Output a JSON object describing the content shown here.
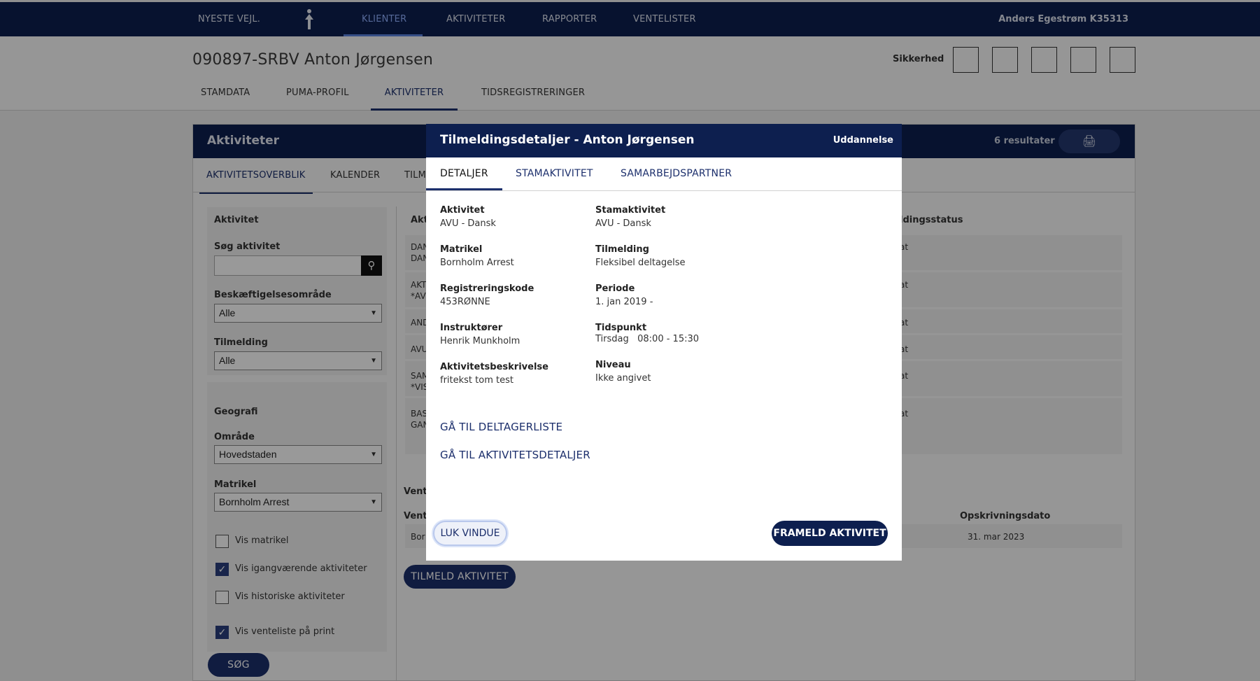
{
  "topnav": {
    "items": [
      {
        "label": "NYESTE VEJL."
      },
      {
        "label": "KLIENTER"
      },
      {
        "label": "AKTIVITETER"
      },
      {
        "label": "RAPPORTER"
      },
      {
        "label": "VENTELISTER"
      }
    ],
    "user": "Anders Egestrøm K35313"
  },
  "client": {
    "title": "090897-SRBV Anton Jørgensen",
    "security_label": "Sikkerhed",
    "tabs": [
      {
        "label": "STAMDATA"
      },
      {
        "label": "PUMA-PROFIL"
      },
      {
        "label": "AKTIVITETER"
      },
      {
        "label": "TIDSREGISTRERINGER"
      }
    ]
  },
  "panel": {
    "title": "Aktiviteter",
    "results": "6 resultater",
    "tabs": [
      {
        "label": "AKTIVITETSOVERBLIK"
      },
      {
        "label": "KALENDER"
      },
      {
        "label": "TILM"
      }
    ]
  },
  "filters": {
    "heading": "Aktivitet",
    "search_label": "Søg aktivitet",
    "search_value": "",
    "area_label": "Beskæftigelsesområde",
    "area_value": "Alle",
    "enrollment_label": "Tilmelding",
    "enrollment_value": "Alle",
    "geo_heading": "Geografi",
    "region_label": "Område",
    "region_value": "Hovedstaden",
    "site_label": "Matrikel",
    "site_value": "Bornholm Arrest",
    "checks": [
      {
        "label": "Vis matrikel",
        "checked": false
      },
      {
        "label": "Vis igangværende aktiviteter",
        "checked": true
      },
      {
        "label": "Vis historiske aktiviteter",
        "checked": false
      },
      {
        "label": "Vis venteliste på print",
        "checked": true
      }
    ],
    "search_button": "SØG"
  },
  "table": {
    "col_activity": "Akt",
    "col_status": "ldingsstatus",
    "rows": [
      {
        "a": "DAN",
        "b": "DAN",
        "status": "at"
      },
      {
        "a": "AKT",
        "b": "*AVU",
        "status": "at"
      },
      {
        "a": "AND",
        "b": "",
        "status": "at"
      },
      {
        "a": "AVU",
        "b": "",
        "status": "at"
      },
      {
        "a": "SAM",
        "b": "*VIS",
        "status": "at"
      },
      {
        "a": "BAS",
        "b": "GAN",
        "status": "at"
      }
    ],
    "waitlist_heading": "Vent",
    "waitlist_col": "Vent",
    "waitlist_date_col": "Opskrivningsdato",
    "waitlist_row_site": "Bor",
    "waitlist_row_date": "31. mar 2023",
    "enroll_button": "TILMELD AKTIVITET"
  },
  "modal": {
    "title": "Tilmeldingsdetaljer - Anton Jørgensen",
    "category": "Uddannelse",
    "tabs": [
      {
        "label": "DETALJER"
      },
      {
        "label": "STAMAKTIVITET"
      },
      {
        "label": "SAMARBEJDSPARTNER"
      }
    ],
    "fields": {
      "activity_label": "Aktivitet",
      "activity_value": "AVU - Dansk",
      "site_label": "Matrikel",
      "site_value": "Bornholm Arrest",
      "regcode_label": "Registreringskode",
      "regcode_value": "453RØNNE",
      "instructors_label": "Instruktører",
      "instructors_value": "Henrik Munkholm",
      "description_label": "Aktivitetsbeskrivelse",
      "description_value": "fritekst tom test",
      "master_label": "Stamaktivitet",
      "master_value": "AVU - Dansk",
      "enrollment_label": "Tilmelding",
      "enrollment_value": "Fleksibel deltagelse",
      "period_label": "Periode",
      "period_value": "1. jan 2019 -",
      "time_label": "Tidspunkt",
      "time_value": "Tirsdag   08:00 - 15:30",
      "level_label": "Niveau",
      "level_value": "Ikke angivet"
    },
    "link_participants": "GÅ TIL DELTAGERLISTE",
    "link_details": "GÅ TIL AKTIVITETSDETALJER",
    "close_button": "LUK VINDUE",
    "unenroll_button": "FRAMELD AKTIVITET"
  }
}
